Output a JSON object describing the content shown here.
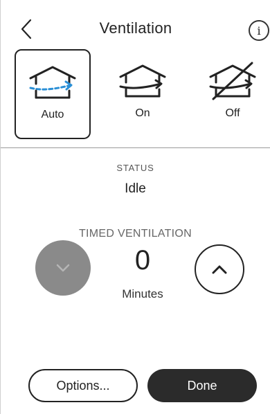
{
  "header": {
    "title": "Ventilation",
    "info_glyph": "i",
    "back_icon": "chevron-left-icon",
    "info_icon": "info-icon"
  },
  "modes": {
    "selected": "Auto",
    "items": [
      {
        "label": "Auto",
        "icon": "house-airflow-auto-icon",
        "selected": true
      },
      {
        "label": "On",
        "icon": "house-airflow-on-icon",
        "selected": false
      },
      {
        "label": "Off",
        "icon": "house-airflow-off-icon",
        "selected": false
      }
    ]
  },
  "status": {
    "label": "STATUS",
    "value": "Idle"
  },
  "timed": {
    "label": "TIMED VENTILATION",
    "value": "0",
    "unit": "Minutes",
    "decrease_icon": "chevron-down-icon",
    "increase_icon": "chevron-up-icon"
  },
  "footer": {
    "options_label": "Options...",
    "done_label": "Done"
  },
  "colors": {
    "accent_airflow": "#2a8fd6",
    "disabled_button": "#8a8a8a",
    "primary_button": "#2b2b2b"
  }
}
